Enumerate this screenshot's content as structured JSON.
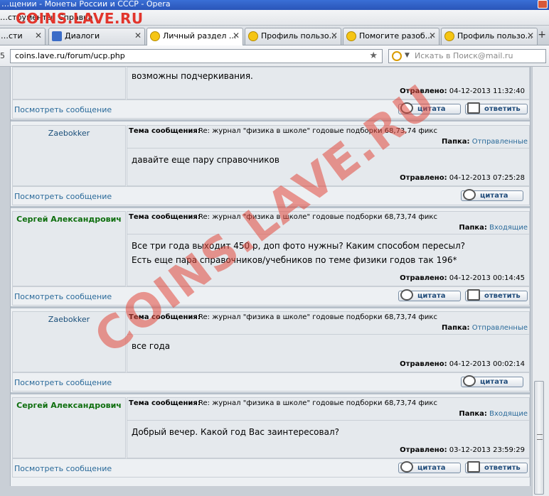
{
  "window": {
    "title": "…щении - Монеты России и СССР - Opera"
  },
  "menu": {
    "items": [
      "…струменты",
      "Справка"
    ]
  },
  "logo_text": "COINS.LAVE.RU",
  "tabs": [
    {
      "label": "…сти",
      "icon": "none",
      "active": false
    },
    {
      "label": "Диалоги",
      "icon": "dialog-icon",
      "active": false
    },
    {
      "label": "Личный раздел ...",
      "icon": "smiley-icon",
      "active": true
    },
    {
      "label": "Профиль пользо...",
      "icon": "smiley-icon",
      "active": false
    },
    {
      "label": "Помогите разоб...",
      "icon": "smiley-icon",
      "active": false
    },
    {
      "label": "Профиль пользо...",
      "icon": "smiley-icon",
      "active": false
    }
  ],
  "new_tab": "+",
  "address": {
    "url": "coins.lave.ru/forum/ucp.php",
    "left_fragment": "5"
  },
  "search": {
    "placeholder": "Искать в Поиск@mail.ru"
  },
  "labels": {
    "subject": "Тема сообщения:",
    "folder": "Папка:",
    "sent": "Отравлено:",
    "view": "Посмотреть сообщение",
    "quote": "цитата",
    "reply": "ответить"
  },
  "messages": [
    {
      "author": "",
      "subject": "",
      "folder": "",
      "text": [
        "возможны подчеркивания."
      ],
      "sent": "04-12-2013 11:32:40",
      "has_reply": true
    },
    {
      "author": "Zaebokker",
      "subject": "Re: журнал \"физика в школе\" годовые подборки 68,73,74 фикс",
      "folder": "Отправленные",
      "text": [
        "давайте еще пару справочников"
      ],
      "sent": "04-12-2013 07:25:28",
      "has_reply": false
    },
    {
      "author": "Сергей Александрович",
      "subject": "Re: журнал \"физика в школе\" годовые подборки 68,73,74 фикс",
      "folder": "Входящие",
      "text": [
        "Все три года выходит 450 р, доп фото нужны? Каким способом пересыл?",
        "Есть еще пара справочников/учебников по теме физики годов так 196*"
      ],
      "sent": "04-12-2013 00:14:45",
      "has_reply": true
    },
    {
      "author": "Zaebokker",
      "subject": "Re: журнал \"физика в школе\" годовые подборки 68,73,74 фикс",
      "folder": "Отправленные",
      "text": [
        "все года"
      ],
      "sent": "04-12-2013 00:02:14",
      "has_reply": false
    },
    {
      "author": "Сергей Александрович",
      "subject": "Re: журнал \"физика в школе\" годовые подборки 68,73,74 фикс",
      "folder": "Входящие",
      "text": [
        "Добрый вечер. Какой год Вас заинтересовал?"
      ],
      "sent": "03-12-2013 23:59:29",
      "has_reply": true
    }
  ],
  "watermark": "COINS.LAVE.RU",
  "colors": {
    "link": "#2a6a9a",
    "author_green": "#0d6e0d",
    "watermark": "#e2483c"
  }
}
